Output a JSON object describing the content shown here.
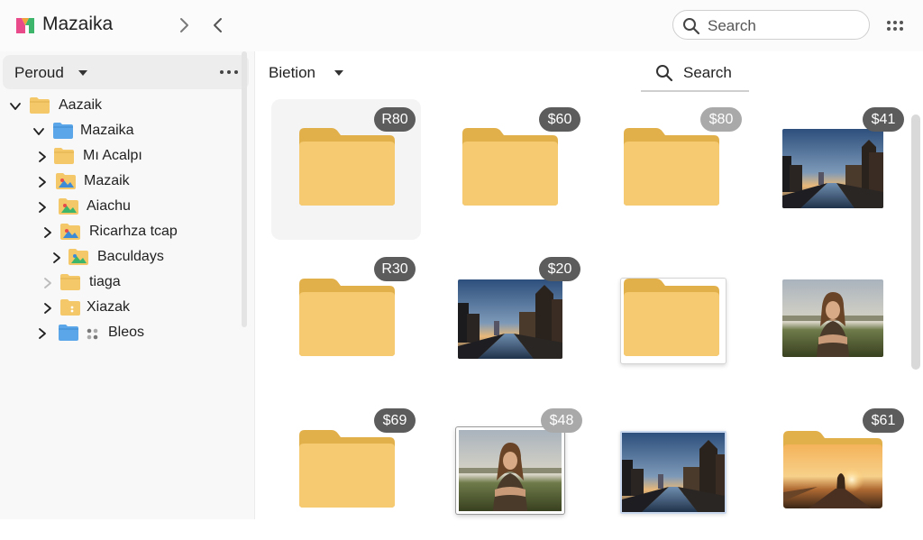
{
  "app": {
    "title": "Mazaika",
    "logo_icon": "mazaika-logo-icon",
    "brand_colors": [
      "#e84a8a",
      "#3db66b"
    ]
  },
  "toolbar": {
    "forward_icon": "chevron-right-icon",
    "back_icon": "chevron-left-icon",
    "search_placeholder": "Search",
    "grid_menu_icon": "grid-dots-icon"
  },
  "sidebar": {
    "header_label": "Peroud",
    "more_icon": "more-horizontal-icon",
    "tree": [
      {
        "label": "Aazaik",
        "icon": "folder-yellow-icon",
        "expanded": true,
        "level": 0
      },
      {
        "label": "Mazaika",
        "icon": "folder-blue-icon",
        "expanded": true,
        "level": 1
      },
      {
        "label": "Mı Acalpı",
        "icon": "folder-yellow-icon",
        "expanded": false,
        "level": 2
      },
      {
        "label": "Mazaik",
        "icon": "folder-image-icon",
        "expanded": false,
        "level": 2
      },
      {
        "label": "Aiachu",
        "icon": "folder-image-icon",
        "expanded": false,
        "level": 2
      },
      {
        "label": "Ricarhza tcap",
        "icon": "folder-image-icon",
        "expanded": false,
        "level": 2
      },
      {
        "label": "Baculdays",
        "icon": "folder-image-icon",
        "expanded": false,
        "level": 3
      },
      {
        "label": "tiaga",
        "icon": "folder-yellow-icon",
        "expanded": false,
        "level": 2
      },
      {
        "label": "Xiazak",
        "icon": "folder-yellow-icon",
        "expanded": false,
        "level": 2
      },
      {
        "label": "Bleos",
        "icon": "folder-blue-icon",
        "expanded": false,
        "level": 2
      }
    ]
  },
  "main": {
    "sort_label": "Bietion",
    "search_tab_label": "Search",
    "colors": {
      "folder": "#f4c869",
      "folder_tab": "#e2b04b",
      "badge_dark": "#5c5c5c",
      "badge_light": "#a9a9a9"
    },
    "items": [
      {
        "badge": "R80",
        "type": "folder",
        "badge_style": "dark",
        "selected": true
      },
      {
        "badge": "$60",
        "type": "folder",
        "badge_style": "dark"
      },
      {
        "badge": "$80",
        "type": "folder",
        "badge_style": "light"
      },
      {
        "badge": "$41",
        "type": "photo-city",
        "badge_style": "dark"
      },
      {
        "badge": "R30",
        "type": "folder",
        "badge_style": "dark"
      },
      {
        "badge": "$20",
        "type": "photo-city",
        "badge_style": "dark"
      },
      {
        "badge": "",
        "type": "folder-framed",
        "badge_style": "none"
      },
      {
        "badge": "",
        "type": "photo-portrait",
        "badge_style": "none"
      },
      {
        "badge": "$69",
        "type": "folder",
        "badge_style": "dark"
      },
      {
        "badge": "$48",
        "type": "photo-portrait-framed",
        "badge_style": "light"
      },
      {
        "badge": "",
        "type": "photo-city-framed",
        "badge_style": "none"
      },
      {
        "badge": "$61",
        "type": "folder-sunset",
        "badge_style": "dark"
      }
    ]
  }
}
